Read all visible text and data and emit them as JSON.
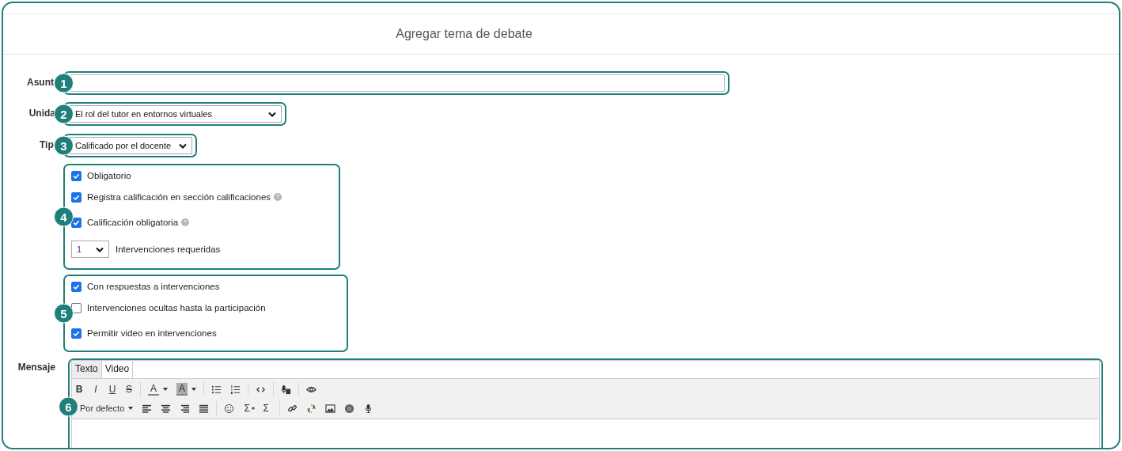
{
  "title": "Agregar tema de debate",
  "subject": {
    "label": "Asunt",
    "badge": "1"
  },
  "unit": {
    "label": "Unida",
    "value": "El rol del tutor en entornos virtuales",
    "badge": "2"
  },
  "type": {
    "label": "Tip",
    "value": "Calificado por el docente",
    "badge": "3"
  },
  "groups": [
    {
      "badge": "4",
      "items": [
        {
          "kind": "checkbox",
          "label": "Obligatorio",
          "checked": true,
          "help": false
        },
        {
          "kind": "checkbox",
          "label": "Registra calificación en sección calificaciones",
          "checked": true,
          "help": true
        },
        {
          "kind": "checkbox",
          "label": "Calificación obligatoria",
          "checked": true,
          "help": true
        },
        {
          "kind": "select",
          "label": "Intervenciones requeridas",
          "count": "1"
        }
      ]
    },
    {
      "badge": "5",
      "items": [
        {
          "kind": "checkbox",
          "label": "Con respuestas a intervenciones",
          "checked": true,
          "help": false
        },
        {
          "kind": "checkbox",
          "label": "Intervenciones ocultas hasta la participación",
          "checked": false,
          "help": false
        },
        {
          "kind": "checkbox",
          "label": "Permitir video en intervenciones",
          "checked": true,
          "help": false
        }
      ]
    }
  ],
  "message": {
    "label": "Mensaje",
    "badge": "6",
    "tabs": [
      {
        "label": "Texto",
        "selected": true
      },
      {
        "label": "Video",
        "selected": false
      }
    ],
    "format": {
      "bold": "B",
      "italic": "I",
      "underline": "U",
      "strike": "S",
      "text_color": "A",
      "highlight": "A"
    },
    "style": "Por defecto",
    "sum_insert": "Σ",
    "sum": "Σ"
  }
}
